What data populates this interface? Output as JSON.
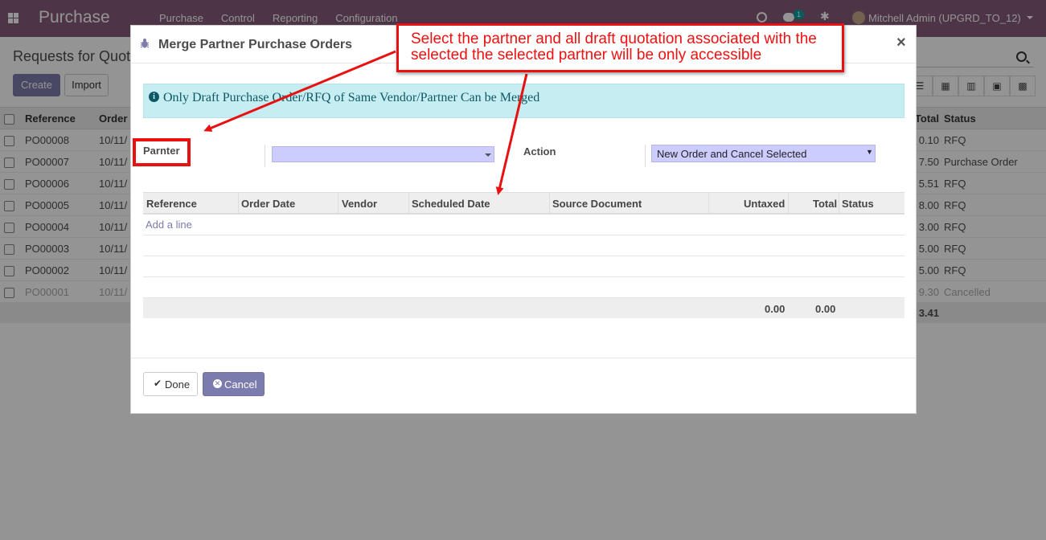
{
  "app": {
    "brand": "Purchase",
    "menu": [
      "Purchase",
      "Control",
      "Reporting",
      "Configuration"
    ],
    "chat_count": "1",
    "user": "Mitchell Admin (UPGRD_TO_12)"
  },
  "control_panel": {
    "title": "Requests for Quot",
    "create_label": "Create",
    "import_label": "Import"
  },
  "list": {
    "columns": [
      "Reference",
      "Order",
      "Total",
      "Status"
    ],
    "rows": [
      {
        "ref": "PO00008",
        "date": "10/11/",
        "total": "0.10",
        "status": "RFQ",
        "cancelled": false
      },
      {
        "ref": "PO00007",
        "date": "10/11/",
        "total": "7.50",
        "status": "Purchase Order",
        "cancelled": false
      },
      {
        "ref": "PO00006",
        "date": "10/11/",
        "total": "5.51",
        "status": "RFQ",
        "cancelled": false
      },
      {
        "ref": "PO00005",
        "date": "10/11/",
        "total": "8.00",
        "status": "RFQ",
        "cancelled": false
      },
      {
        "ref": "PO00004",
        "date": "10/11/",
        "total": "3.00",
        "status": "RFQ",
        "cancelled": false
      },
      {
        "ref": "PO00003",
        "date": "10/11/",
        "total": "5.00",
        "status": "RFQ",
        "cancelled": false
      },
      {
        "ref": "PO00002",
        "date": "10/11/",
        "total": "5.00",
        "status": "RFQ",
        "cancelled": false
      },
      {
        "ref": "PO00001",
        "date": "10/11/",
        "total": "9.30",
        "status": "Cancelled",
        "cancelled": true
      }
    ],
    "footer_total": "3.41"
  },
  "modal": {
    "title": "Merge Partner Purchase Orders",
    "close_glyph": "×",
    "alert_text": "Only Draft Purchase Order/RFQ of Same Vendor/Partner Can be Merged",
    "partner_label": "Parnter",
    "partner_value": "",
    "action_label": "Action",
    "action_value": "New Order and Cancel Selected",
    "lines_columns": {
      "reference": "Reference",
      "order_date": "Order Date",
      "vendor": "Vendor",
      "scheduled_date": "Scheduled Date",
      "source_document": "Source Document",
      "untaxed": "Untaxed",
      "total": "Total",
      "status": "Status"
    },
    "add_line": "Add a line",
    "untaxed_sum": "0.00",
    "total_sum": "0.00",
    "done_label": "Done",
    "cancel_label": "Cancel"
  },
  "annotation": {
    "text": "Select the partner and all draft quotation associated with the selected the selected partner will be only accessible",
    "color": "#e81010"
  },
  "colors": {
    "brand": "#875a7b",
    "primary": "#7c7bad",
    "alert_bg": "#c6edf1",
    "field_bg": "#ccccff"
  }
}
